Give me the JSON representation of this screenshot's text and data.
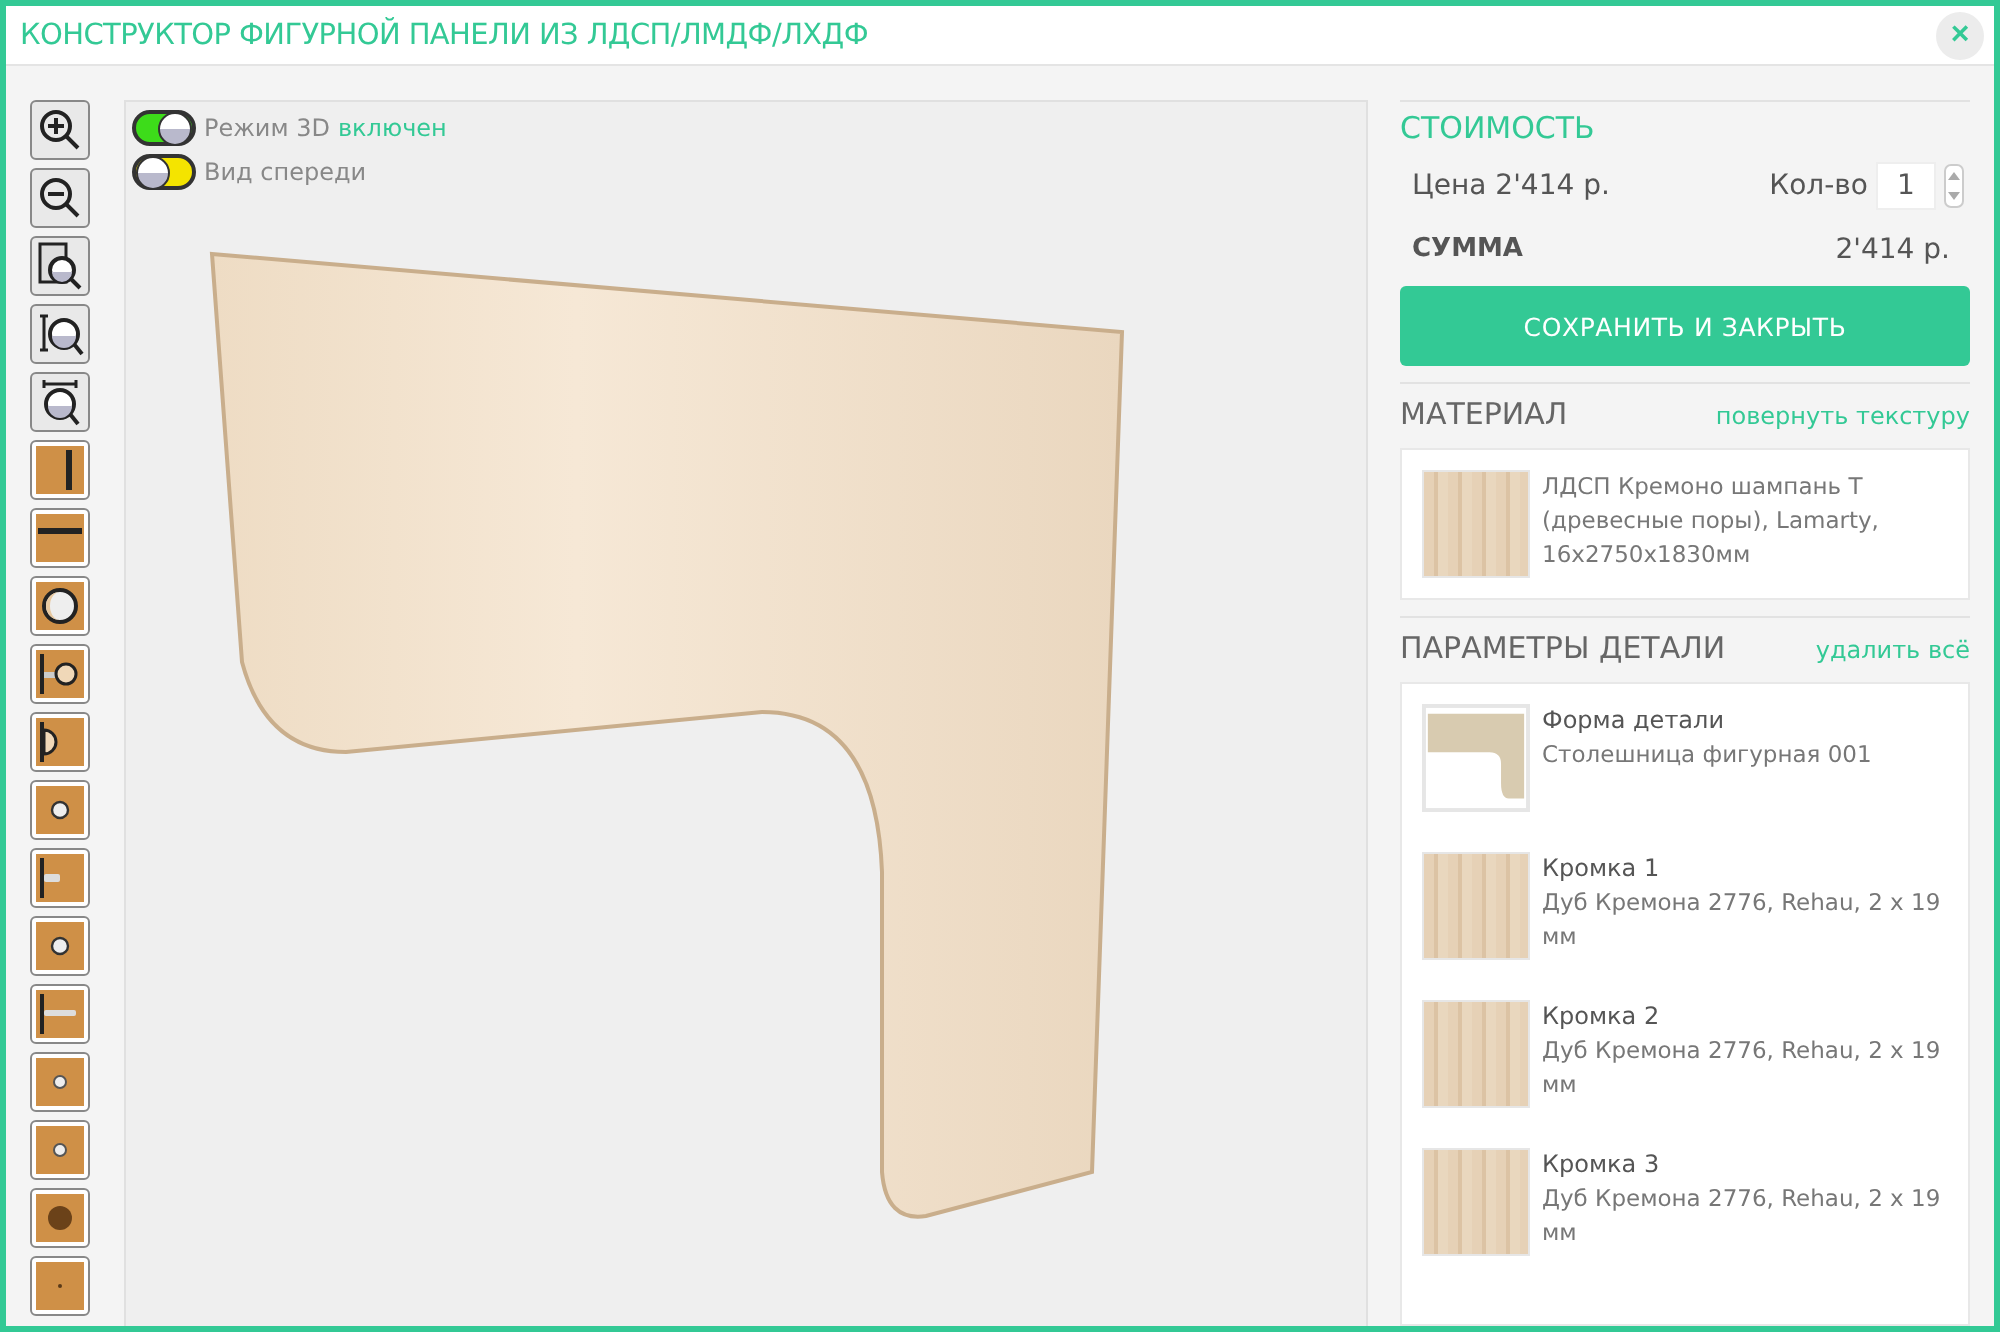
{
  "window": {
    "title": "КОНСТРУКТОР ФИГУРНОЙ ПАНЕЛИ ИЗ ЛДСП/ЛМДФ/ЛХДФ",
    "close": "×"
  },
  "tools": [
    {
      "kind": "zoom-in"
    },
    {
      "kind": "zoom-out"
    },
    {
      "kind": "zoom-page"
    },
    {
      "kind": "zoom-height"
    },
    {
      "kind": "zoom-width"
    },
    {
      "kind": "edge-vertical"
    },
    {
      "kind": "edge-horizontal"
    },
    {
      "kind": "circle-big"
    },
    {
      "kind": "bar-circle"
    },
    {
      "kind": "bar-half"
    },
    {
      "kind": "circle-small"
    },
    {
      "kind": "bar-stub"
    },
    {
      "kind": "circle-small"
    },
    {
      "kind": "bar-long"
    },
    {
      "kind": "circle-tiny"
    },
    {
      "kind": "circle-tiny"
    },
    {
      "kind": "circle-dark"
    },
    {
      "kind": "dot"
    }
  ],
  "toggles": [
    {
      "label": "Режим 3D",
      "status": "включен",
      "on": true
    },
    {
      "label": "Вид спереди",
      "on": false
    }
  ],
  "cost": {
    "title": "СТОИМОСТЬ",
    "price": "Цена 2'414 р.",
    "qty_label": "Кол-во",
    "qty": "1",
    "sum_label": "СУММА",
    "sum": "2'414 р."
  },
  "save_button": "СОХРАНИТЬ И ЗАКРЫТЬ",
  "material": {
    "title": "МАТЕРИАЛ",
    "action": "повернуть текстуру",
    "text": "ЛДСП Кремоно шампань Т (древесные поры), Lamarty, 16х2750х1830мм"
  },
  "params": {
    "title": "ПАРАМЕТРЫ ДЕТАЛИ",
    "action": "удалить всё",
    "items": [
      {
        "kind": "shape",
        "name": "Форма детали",
        "value": "Столешница фигурная 001"
      },
      {
        "kind": "wood",
        "name": "Кромка 1",
        "value": "Дуб Кремона 2776, Rehau, 2 x 19 мм"
      },
      {
        "kind": "wood",
        "name": "Кромка 2",
        "value": "Дуб Кремона 2776, Rehau, 2 x 19 мм"
      },
      {
        "kind": "wood",
        "name": "Кромка 3",
        "value": "Дуб Кремона 2776, Rehau, 2 x 19 мм"
      }
    ]
  }
}
